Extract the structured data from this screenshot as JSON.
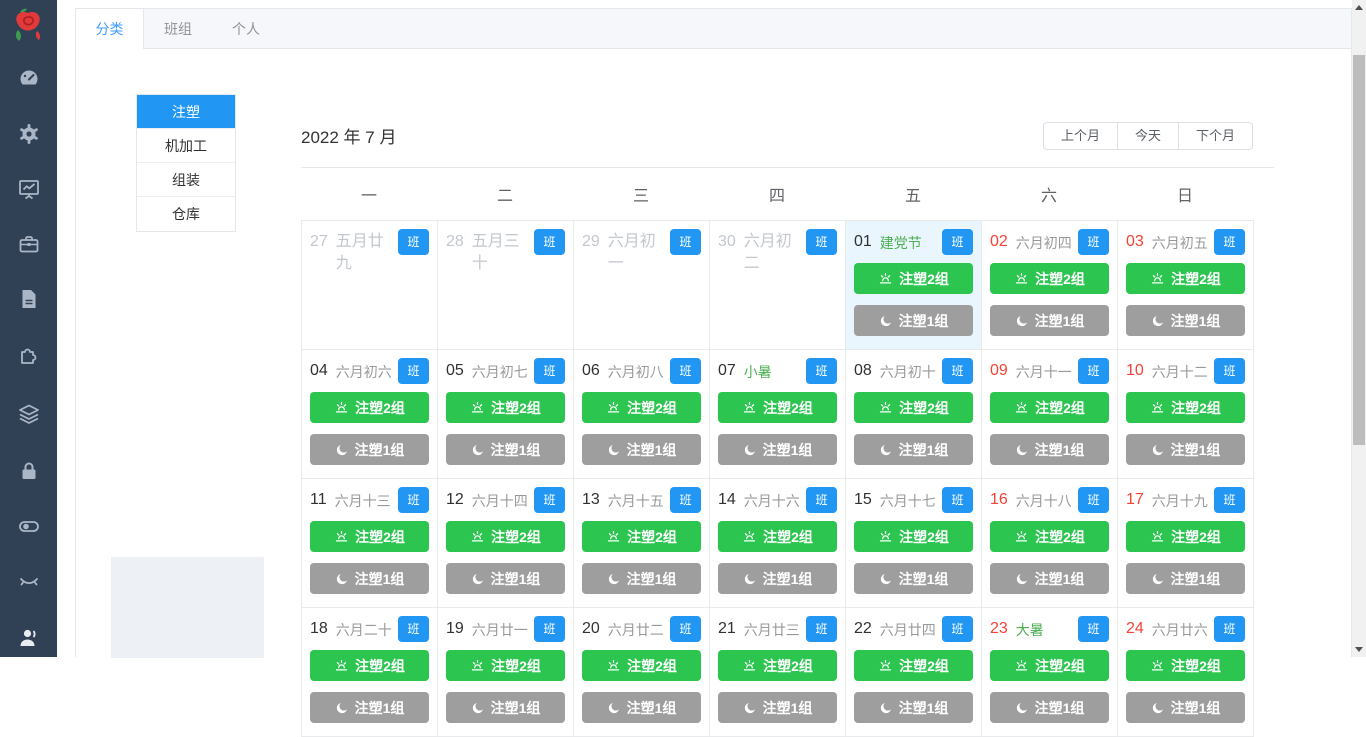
{
  "tabs": [
    {
      "label": "分类",
      "active": true
    },
    {
      "label": "班组",
      "active": false
    },
    {
      "label": "个人",
      "active": false
    }
  ],
  "categories": [
    {
      "label": "注塑",
      "active": true
    },
    {
      "label": "机加工",
      "active": false
    },
    {
      "label": "组装",
      "active": false
    },
    {
      "label": "仓库",
      "active": false
    }
  ],
  "sidebar": {
    "icons": [
      "dashboard-icon",
      "settings-icon",
      "monitor-chart-icon",
      "briefcase-icon",
      "document-icon",
      "puzzle-icon",
      "layers-icon",
      "lock-icon",
      "toggle-icon",
      "eye-closed-icon",
      "user-icon"
    ]
  },
  "calendar": {
    "title": "2022 年 7 月",
    "controls": {
      "prev": "上个月",
      "today": "今天",
      "next": "下个月"
    },
    "weekdays": [
      "一",
      "二",
      "三",
      "四",
      "五",
      "六",
      "日"
    ],
    "badge_label": "班",
    "day_shift_label": "注塑2组",
    "night_shift_label": "注塑1组",
    "weeks": [
      [
        {
          "num": "27",
          "lunar": "五月廿九",
          "other": true
        },
        {
          "num": "28",
          "lunar": "五月三十",
          "other": true
        },
        {
          "num": "29",
          "lunar": "六月初一",
          "other": true
        },
        {
          "num": "30",
          "lunar": "六月初二",
          "other": true
        },
        {
          "num": "01",
          "lunar": "建党节",
          "lunar_green": true,
          "selected": true,
          "shifts": true
        },
        {
          "num": "02",
          "lunar": "六月初四",
          "red": true,
          "shifts": true
        },
        {
          "num": "03",
          "lunar": "六月初五",
          "red": true,
          "shifts": true
        }
      ],
      [
        {
          "num": "04",
          "lunar": "六月初六",
          "shifts": true
        },
        {
          "num": "05",
          "lunar": "六月初七",
          "shifts": true
        },
        {
          "num": "06",
          "lunar": "六月初八",
          "shifts": true
        },
        {
          "num": "07",
          "lunar": "小暑",
          "lunar_green": true,
          "shifts": true
        },
        {
          "num": "08",
          "lunar": "六月初十",
          "shifts": true
        },
        {
          "num": "09",
          "lunar": "六月十一",
          "red": true,
          "shifts": true
        },
        {
          "num": "10",
          "lunar": "六月十二",
          "red": true,
          "shifts": true
        }
      ],
      [
        {
          "num": "11",
          "lunar": "六月十三",
          "shifts": true
        },
        {
          "num": "12",
          "lunar": "六月十四",
          "shifts": true
        },
        {
          "num": "13",
          "lunar": "六月十五",
          "shifts": true
        },
        {
          "num": "14",
          "lunar": "六月十六",
          "shifts": true
        },
        {
          "num": "15",
          "lunar": "六月十七",
          "shifts": true
        },
        {
          "num": "16",
          "lunar": "六月十八",
          "red": true,
          "shifts": true
        },
        {
          "num": "17",
          "lunar": "六月十九",
          "red": true,
          "shifts": true
        }
      ],
      [
        {
          "num": "18",
          "lunar": "六月二十",
          "shifts": true
        },
        {
          "num": "19",
          "lunar": "六月廿一",
          "shifts": true
        },
        {
          "num": "20",
          "lunar": "六月廿二",
          "shifts": true
        },
        {
          "num": "21",
          "lunar": "六月廿三",
          "shifts": true
        },
        {
          "num": "22",
          "lunar": "六月廿四",
          "shifts": true
        },
        {
          "num": "23",
          "lunar": "大暑",
          "red": true,
          "lunar_green": true,
          "shifts": true
        },
        {
          "num": "24",
          "lunar": "六月廿六",
          "red": true,
          "shifts": true
        }
      ]
    ]
  },
  "colors": {
    "primary": "#2196f3",
    "day_shift_green": "#2bc550",
    "night_shift_gray": "#9e9e9e",
    "weekend_red": "#f44336",
    "holiday_green": "#4caf50",
    "selected_cell_bg": "#e9f6fe",
    "sidebar_bg": "#304156"
  }
}
